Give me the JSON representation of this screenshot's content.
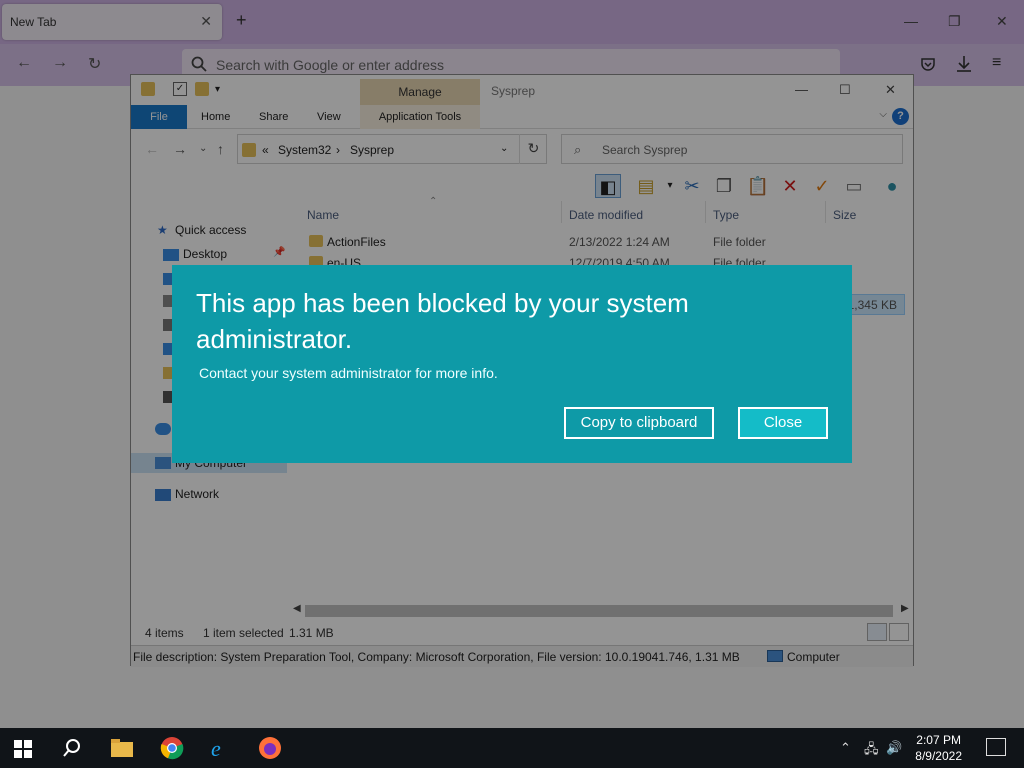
{
  "browser": {
    "tab_title": "New Tab",
    "tab_close": "✕",
    "new_tab": "+",
    "minimize": "—",
    "restore": "❐",
    "close": "✕",
    "back": "←",
    "forward": "→",
    "reload": "↻",
    "url_placeholder": "Search with Google or enter address",
    "menu": "≡"
  },
  "explorer": {
    "title": "Sysprep",
    "manage_tab": "Manage",
    "ribbon_tabs": [
      "File",
      "Home",
      "Share",
      "View",
      "Application Tools"
    ],
    "help": "?",
    "address": {
      "prefix": "«",
      "parts": [
        "System32",
        "Sysprep"
      ],
      "sep": "›"
    },
    "search_placeholder": "Search Sysprep",
    "nav": {
      "quick_access": "Quick access",
      "desktop": "Desktop",
      "my_computer": "My Computer",
      "network": "Network"
    },
    "columns": {
      "name": "Name",
      "date": "Date modified",
      "type": "Type",
      "size": "Size"
    },
    "files": [
      {
        "name": "ActionFiles",
        "date": "2/13/2022 1:24 AM",
        "type": "File folder",
        "size": ""
      },
      {
        "name": "en-US",
        "date": "12/7/2019 4:50 AM",
        "type": "File folder",
        "size": ""
      }
    ],
    "selected_size": "1,345 KB",
    "status": {
      "items": "4 items",
      "selected": "1 item selected",
      "size": "1.31 MB"
    },
    "description": "File description: System Preparation Tool, Company: Microsoft Corporation, File version: 10.0.19041.746, 1.31 MB",
    "computer_label": "Computer"
  },
  "dialog": {
    "title": "This app has been blocked by your system administrator.",
    "message": "Contact your system administrator for more info.",
    "copy_button": "Copy to clipboard",
    "close_button": "Close"
  },
  "taskbar": {
    "time": "2:07 PM",
    "date": "8/9/2022"
  }
}
